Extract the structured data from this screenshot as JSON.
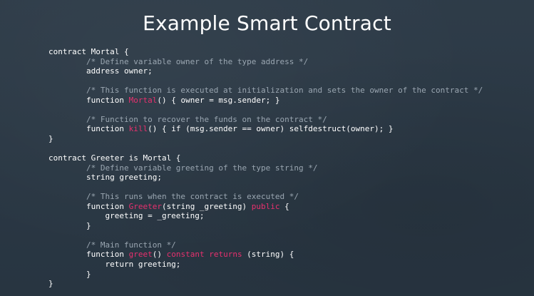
{
  "slide": {
    "title": "Example Smart Contract"
  },
  "code": {
    "lines": [
      [
        {
          "t": "contract Mortal {",
          "c": "plain"
        }
      ],
      [
        {
          "t": "        /* Define variable owner of the type address */",
          "c": "comment"
        }
      ],
      [
        {
          "t": "        address owner;",
          "c": "plain"
        }
      ],
      [],
      [
        {
          "t": "        /* This function is executed at initialization and sets the owner of the contract */",
          "c": "comment"
        }
      ],
      [
        {
          "t": "        function ",
          "c": "plain"
        },
        {
          "t": "Mortal",
          "c": "pink"
        },
        {
          "t": "() { owner = msg.sender; }",
          "c": "plain"
        }
      ],
      [],
      [
        {
          "t": "        /* Function to recover the funds on the contract */",
          "c": "comment"
        }
      ],
      [
        {
          "t": "        function ",
          "c": "plain"
        },
        {
          "t": "kill",
          "c": "pink"
        },
        {
          "t": "() { if (msg.sender == owner) selfdestruct(owner); }",
          "c": "plain"
        }
      ],
      [
        {
          "t": "}",
          "c": "plain"
        }
      ],
      [],
      [
        {
          "t": "contract Greeter is Mortal {",
          "c": "plain"
        }
      ],
      [
        {
          "t": "        /* Define variable greeting of the type string */",
          "c": "comment"
        }
      ],
      [
        {
          "t": "        string greeting;",
          "c": "plain"
        }
      ],
      [],
      [
        {
          "t": "        /* This runs when the contract is executed */",
          "c": "comment"
        }
      ],
      [
        {
          "t": "        function ",
          "c": "plain"
        },
        {
          "t": "Greeter",
          "c": "pink"
        },
        {
          "t": "(string _greeting) ",
          "c": "plain"
        },
        {
          "t": "public",
          "c": "pink"
        },
        {
          "t": " {",
          "c": "plain"
        }
      ],
      [
        {
          "t": "            greeting = _greeting;",
          "c": "plain"
        }
      ],
      [
        {
          "t": "        }",
          "c": "plain"
        }
      ],
      [],
      [
        {
          "t": "        /* Main function */",
          "c": "comment"
        }
      ],
      [
        {
          "t": "        function ",
          "c": "plain"
        },
        {
          "t": "greet",
          "c": "pink"
        },
        {
          "t": "() ",
          "c": "plain"
        },
        {
          "t": "constant",
          "c": "pink"
        },
        {
          "t": " ",
          "c": "plain"
        },
        {
          "t": "returns",
          "c": "pink"
        },
        {
          "t": " (string) {",
          "c": "plain"
        }
      ],
      [
        {
          "t": "            return greeting;",
          "c": "plain"
        }
      ],
      [
        {
          "t": "        }",
          "c": "plain"
        }
      ],
      [
        {
          "t": "}",
          "c": "plain"
        }
      ]
    ]
  },
  "colors": {
    "background": "#2a3845",
    "keyword_highlight": "#e8306e",
    "comment": "#9aa6b1",
    "text": "#ffffff"
  }
}
